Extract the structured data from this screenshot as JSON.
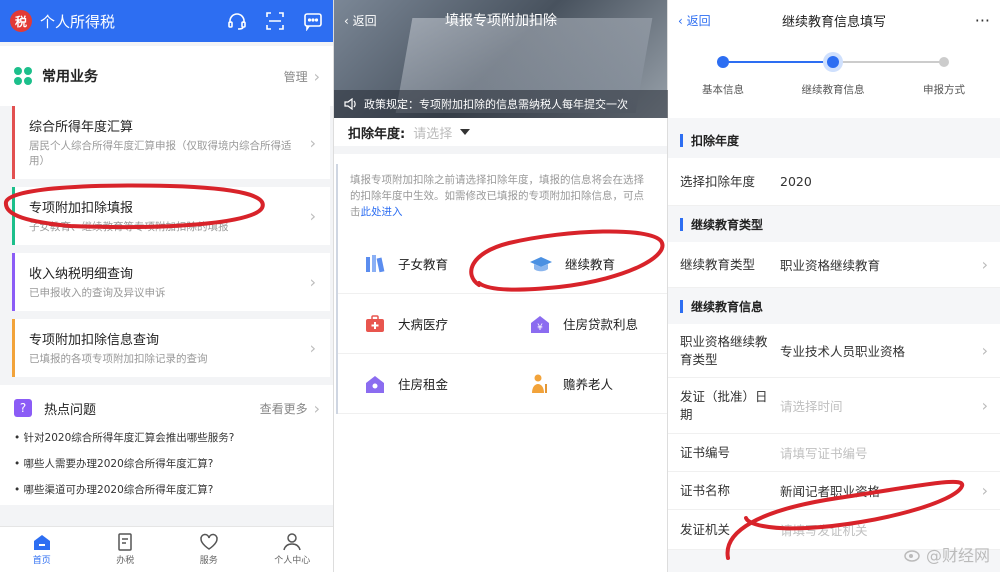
{
  "panel1": {
    "title": "个人所得税",
    "logo_char": "税",
    "section_title": "常用业务",
    "manage_label": "管理",
    "cards": [
      {
        "title": "综合所得年度汇算",
        "desc": "居民个人综合所得年度汇算申报（仅取得境内综合所得适用）",
        "color": "#e25050"
      },
      {
        "title": "专项附加扣除填报",
        "desc": "子女教育、继续教育等专项附加扣除的填报",
        "color": "#1cbf8b"
      },
      {
        "title": "收入纳税明细查询",
        "desc": "已申报收入的查询及异议申诉",
        "color": "#8b5cf6"
      },
      {
        "title": "专项附加扣除信息查询",
        "desc": "已填报的各项专项附加扣除记录的查询",
        "color": "#f2a33a"
      }
    ],
    "hot_title": "热点问题",
    "hot_more": "查看更多",
    "hot_items": [
      "针对2020综合所得年度汇算会推出哪些服务?",
      "哪些人需要办理2020综合所得年度汇算?",
      "哪些渠道可办理2020综合所得年度汇算?"
    ],
    "tabs": [
      "首页",
      "办税",
      "服务",
      "个人中心"
    ]
  },
  "panel2": {
    "back": "返回",
    "title": "填报专项附加扣除",
    "notice": "政策规定：专项附加扣除的信息需纳税人每年提交一次",
    "year_label": "扣除年度:",
    "year_placeholder": "请选择",
    "intro": "填报专项附加扣除之前请选择扣除年度，填报的信息将会在选择的扣除年度中生效。如需修改已填报的专项附加扣除信息，可点击",
    "intro_link": "此处进入",
    "items": [
      "子女教育",
      "继续教育",
      "大病医疗",
      "住房贷款利息",
      "住房租金",
      "赡养老人"
    ]
  },
  "panel3": {
    "back": "返回",
    "title": "继续教育信息填写",
    "more": "···",
    "steps": [
      "基本信息",
      "继续教育信息",
      "申报方式"
    ],
    "g1_title": "扣除年度",
    "g1_label": "选择扣除年度",
    "g1_value": "2020",
    "g2_title": "继续教育类型",
    "g2_label": "继续教育类型",
    "g2_value": "职业资格继续教育",
    "g3_title": "继续教育信息",
    "r1_label": "职业资格继续教育类型",
    "r1_value": "专业技术人员职业资格",
    "r2_label": "发证（批准）日期",
    "r2_placeholder": "请选择时间",
    "r3_label": "证书编号",
    "r3_placeholder": "请填写证书编号",
    "r4_label": "证书名称",
    "r4_value": "新闻记者职业资格",
    "r5_label": "发证机关",
    "r5_placeholder": "请填写发证机关",
    "watermark": "@财经网"
  },
  "colors": {
    "brand": "#2d6ef2",
    "annotation": "#d8232a"
  }
}
